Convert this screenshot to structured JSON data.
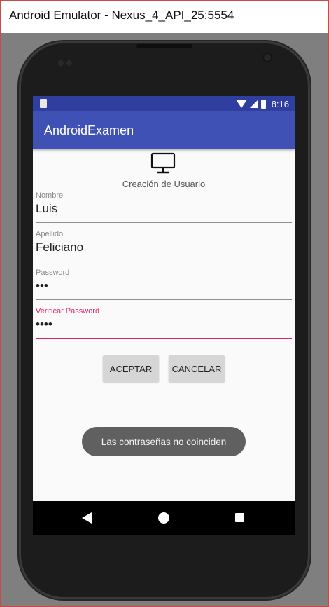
{
  "window": {
    "title": "Android Emulator - Nexus_4_API_25:5554"
  },
  "statusbar": {
    "time": "8:16"
  },
  "app": {
    "title": "AndroidExamen"
  },
  "form": {
    "heading": "Creación de Usuario",
    "fields": [
      {
        "label": "Nombre",
        "value": "Luis"
      },
      {
        "label": "Apellido",
        "value": "Feliciano"
      },
      {
        "label": "Password",
        "value": "•••"
      },
      {
        "label": "Verificar Password",
        "value": "••••"
      }
    ],
    "accept_label": "ACEPTAR",
    "cancel_label": "CANCELAR"
  },
  "toast": {
    "message": "Las contraseñas no coinciden"
  },
  "colors": {
    "statusbar": "#303f9f",
    "appbar": "#3f51b5",
    "accent": "#e91e63"
  },
  "icons": {
    "header": "monitor-icon",
    "status": [
      "sd-card-icon",
      "wifi-icon",
      "signal-icon",
      "battery-icon"
    ],
    "nav": [
      "back-icon",
      "home-icon",
      "recents-icon"
    ]
  }
}
